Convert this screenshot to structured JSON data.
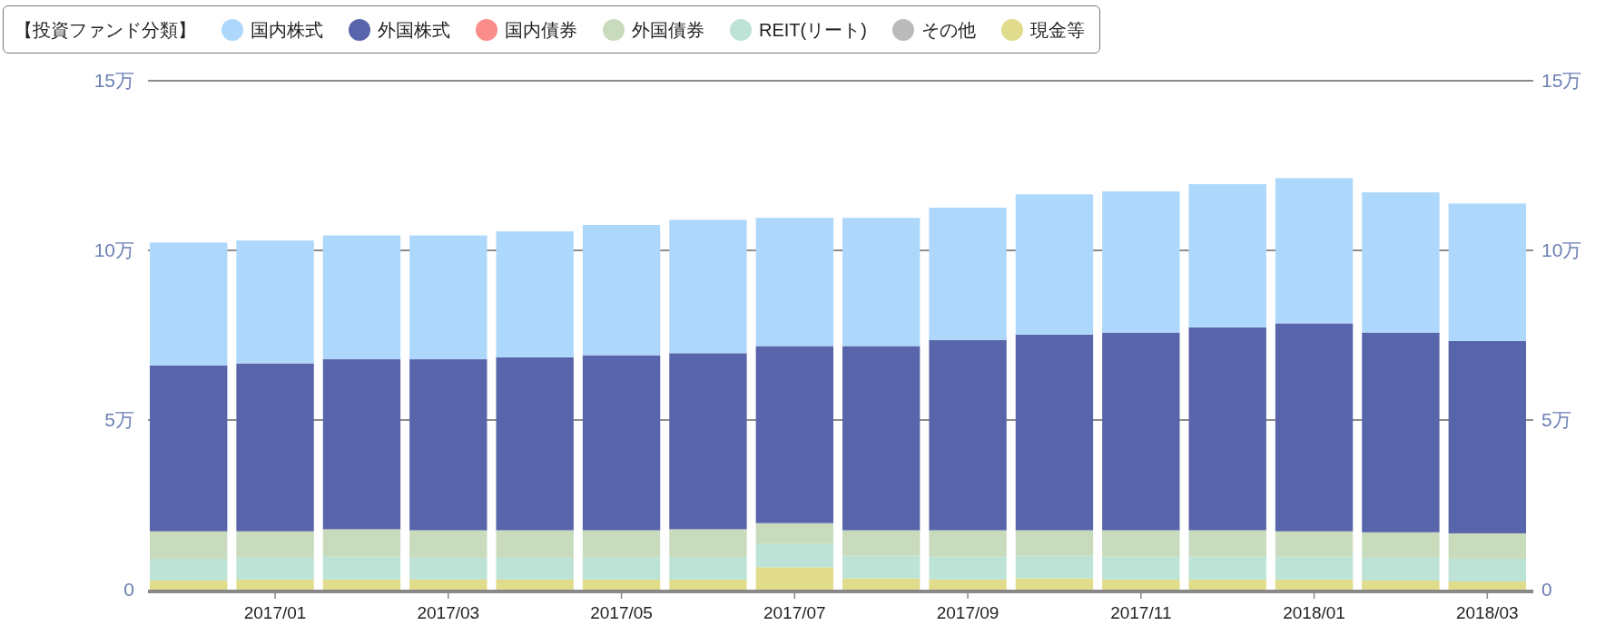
{
  "chart": {
    "chart_data": {
      "type": "bar",
      "stacked": true,
      "title": "【投資ファンド分類】",
      "legend": true,
      "categories": [
        null,
        "2017/01",
        null,
        "2017/03",
        null,
        "2017/05",
        null,
        "2017/07",
        null,
        "2017/09",
        null,
        "2017/11",
        null,
        "2018/01",
        null,
        "2018/03"
      ],
      "ylim": [
        0,
        15
      ],
      "yticks": [
        {
          "value": 0,
          "label": "0"
        },
        {
          "value": 5,
          "label": "5万"
        },
        {
          "value": 10,
          "label": "10万"
        },
        {
          "value": 15,
          "label": "15万"
        }
      ],
      "series": [
        {
          "name": "国内株式",
          "color": "#add8fb",
          "values": [
            3.62,
            3.62,
            3.65,
            3.65,
            3.71,
            3.84,
            3.93,
            3.78,
            3.78,
            3.9,
            4.13,
            4.16,
            4.22,
            4.28,
            4.13,
            4.05
          ]
        },
        {
          "name": "外国株式",
          "color": "#5865aa",
          "values": [
            4.89,
            4.95,
            5.01,
            5.04,
            5.1,
            5.16,
            5.19,
            5.22,
            5.43,
            5.61,
            5.77,
            5.83,
            5.98,
            6.13,
            5.89,
            5.67
          ]
        },
        {
          "name": "国内債券",
          "color": "#fa8c8a",
          "values": [
            0,
            0,
            0,
            0,
            0,
            0,
            0,
            0,
            0,
            0,
            0,
            0,
            0,
            0,
            0,
            0
          ]
        },
        {
          "name": "外国債券",
          "color": "#c8dbbd",
          "values": [
            0.81,
            0.78,
            0.81,
            0.81,
            0.81,
            0.81,
            0.84,
            0.6,
            0.75,
            0.78,
            0.75,
            0.78,
            0.78,
            0.75,
            0.75,
            0.75
          ]
        },
        {
          "name": "REIT(リート)",
          "color": "#bce3d6",
          "values": [
            0.64,
            0.64,
            0.67,
            0.64,
            0.64,
            0.64,
            0.64,
            0.7,
            0.67,
            0.67,
            0.67,
            0.67,
            0.67,
            0.67,
            0.67,
            0.67
          ]
        },
        {
          "name": "その他",
          "color": "#bbbbbb",
          "values": [
            0,
            0,
            0,
            0,
            0,
            0,
            0,
            0,
            0,
            0,
            0,
            0,
            0,
            0,
            0,
            0
          ]
        },
        {
          "name": "現金等",
          "color": "#e0dc8b",
          "values": [
            0.27,
            0.3,
            0.3,
            0.3,
            0.3,
            0.3,
            0.3,
            0.66,
            0.33,
            0.3,
            0.33,
            0.3,
            0.3,
            0.3,
            0.27,
            0.24
          ]
        }
      ]
    }
  }
}
